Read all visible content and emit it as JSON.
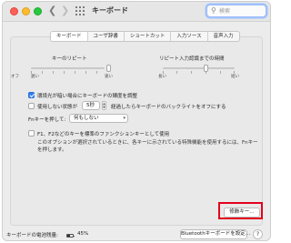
{
  "window": {
    "title": "キーボード",
    "search": {
      "placeholder": "検索",
      "value": ""
    }
  },
  "tabs": [
    {
      "label": "キーボード",
      "active": true
    },
    {
      "label": "ユーザ辞書",
      "active": false
    },
    {
      "label": "ショートカット",
      "active": false
    },
    {
      "label": "入力ソース",
      "active": false
    },
    {
      "label": "音声入力",
      "active": false
    }
  ],
  "key_repeat": {
    "title": "キーのリピート",
    "scale": [
      "オフ",
      "遅い",
      "速い"
    ]
  },
  "repeat_delay": {
    "title": "リピート入力認識までの時間",
    "scale": [
      "長い",
      "短い"
    ]
  },
  "options": {
    "adjust_brightness": {
      "label": "環境光が暗い場合にキーボードの輝度を調整",
      "checked": true
    },
    "backlight_off": {
      "label_before": "使用しない状態が",
      "duration": "5秒",
      "label_after": "経過したらキーボードのバックライトをオフにする",
      "checked": false
    },
    "fn_key": {
      "label": "Fnキーを押して:",
      "value": "何もしない"
    },
    "function_keys": {
      "label": "F1、F2などのキーを標準のファンクションキーとして使用",
      "description_1": "このオプションが選択されているときに、各キーに示されている特殊機能を使用するには、Fnキー",
      "description_2": "を押します。",
      "checked": false
    }
  },
  "buttons": {
    "modifier_keys": "修飾キー…",
    "bluetooth_setup": "Bluetoothキーボードを設定…",
    "help": "?"
  },
  "footer": {
    "battery_label": "キーボードの電池残量:",
    "battery_level": "45%"
  },
  "colors": {
    "accent": "#2f7cf6",
    "highlight_box": "#e3001b"
  }
}
